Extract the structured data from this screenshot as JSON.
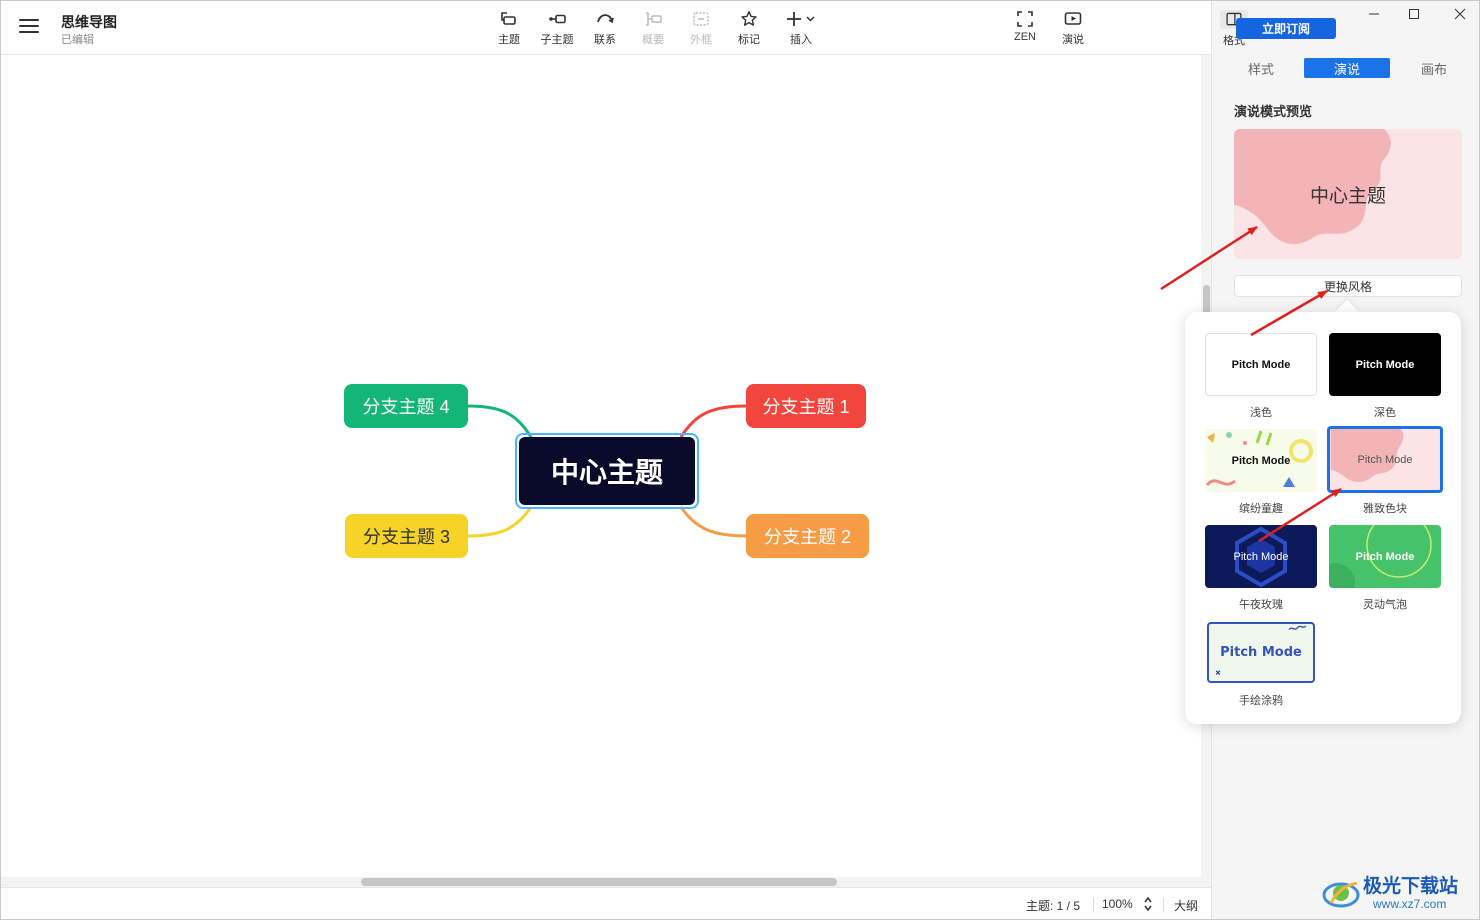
{
  "window": {
    "title": "思维导图",
    "status": "已编辑"
  },
  "toolbar": {
    "items": [
      {
        "label": "主题",
        "icon": "topic-icon",
        "enabled": true
      },
      {
        "label": "子主题",
        "icon": "subtopic-icon",
        "enabled": true
      },
      {
        "label": "联系",
        "icon": "relationship-icon",
        "enabled": true
      },
      {
        "label": "概要",
        "icon": "summary-icon",
        "enabled": false
      },
      {
        "label": "外框",
        "icon": "boundary-icon",
        "enabled": false
      },
      {
        "label": "标记",
        "icon": "star-icon",
        "enabled": true
      },
      {
        "label": "插入",
        "icon": "plus-icon",
        "enabled": true
      }
    ],
    "zen_label": "ZEN",
    "present_label": "演说",
    "format_label": "格式"
  },
  "mindmap": {
    "central": "中心主题",
    "branches": [
      {
        "label": "分支主题 1",
        "color": "#f2453d"
      },
      {
        "label": "分支主题 2",
        "color": "#f59c45"
      },
      {
        "label": "分支主题 3",
        "color": "#f5d327"
      },
      {
        "label": "分支主题 4",
        "color": "#13b677"
      }
    ]
  },
  "statusbar": {
    "topics": "主题: 1 / 5",
    "zoom": "100%",
    "outline": "大纲"
  },
  "panel": {
    "subscribe_label": "立即订阅",
    "tabs": [
      {
        "label": "样式",
        "active": false
      },
      {
        "label": "演说",
        "active": true
      },
      {
        "label": "画布",
        "active": false
      }
    ],
    "section_title": "演说模式预览",
    "preview_text": "中心主题",
    "change_style_label": "更换风格",
    "accent_color": "#1a73e8"
  },
  "style_picker": {
    "card_text": "Pitch Mode",
    "styles": [
      {
        "name": "浅色",
        "selected": false
      },
      {
        "name": "深色",
        "selected": false
      },
      {
        "name": "缤纷童趣",
        "selected": false
      },
      {
        "name": "雅致色块",
        "selected": true
      },
      {
        "name": "午夜玫瑰",
        "selected": false
      },
      {
        "name": "灵动气泡",
        "selected": false
      },
      {
        "name": "手绘涂鸦",
        "selected": false
      }
    ]
  },
  "watermark": {
    "name": "极光下载站",
    "url": "www.xz7.com"
  }
}
